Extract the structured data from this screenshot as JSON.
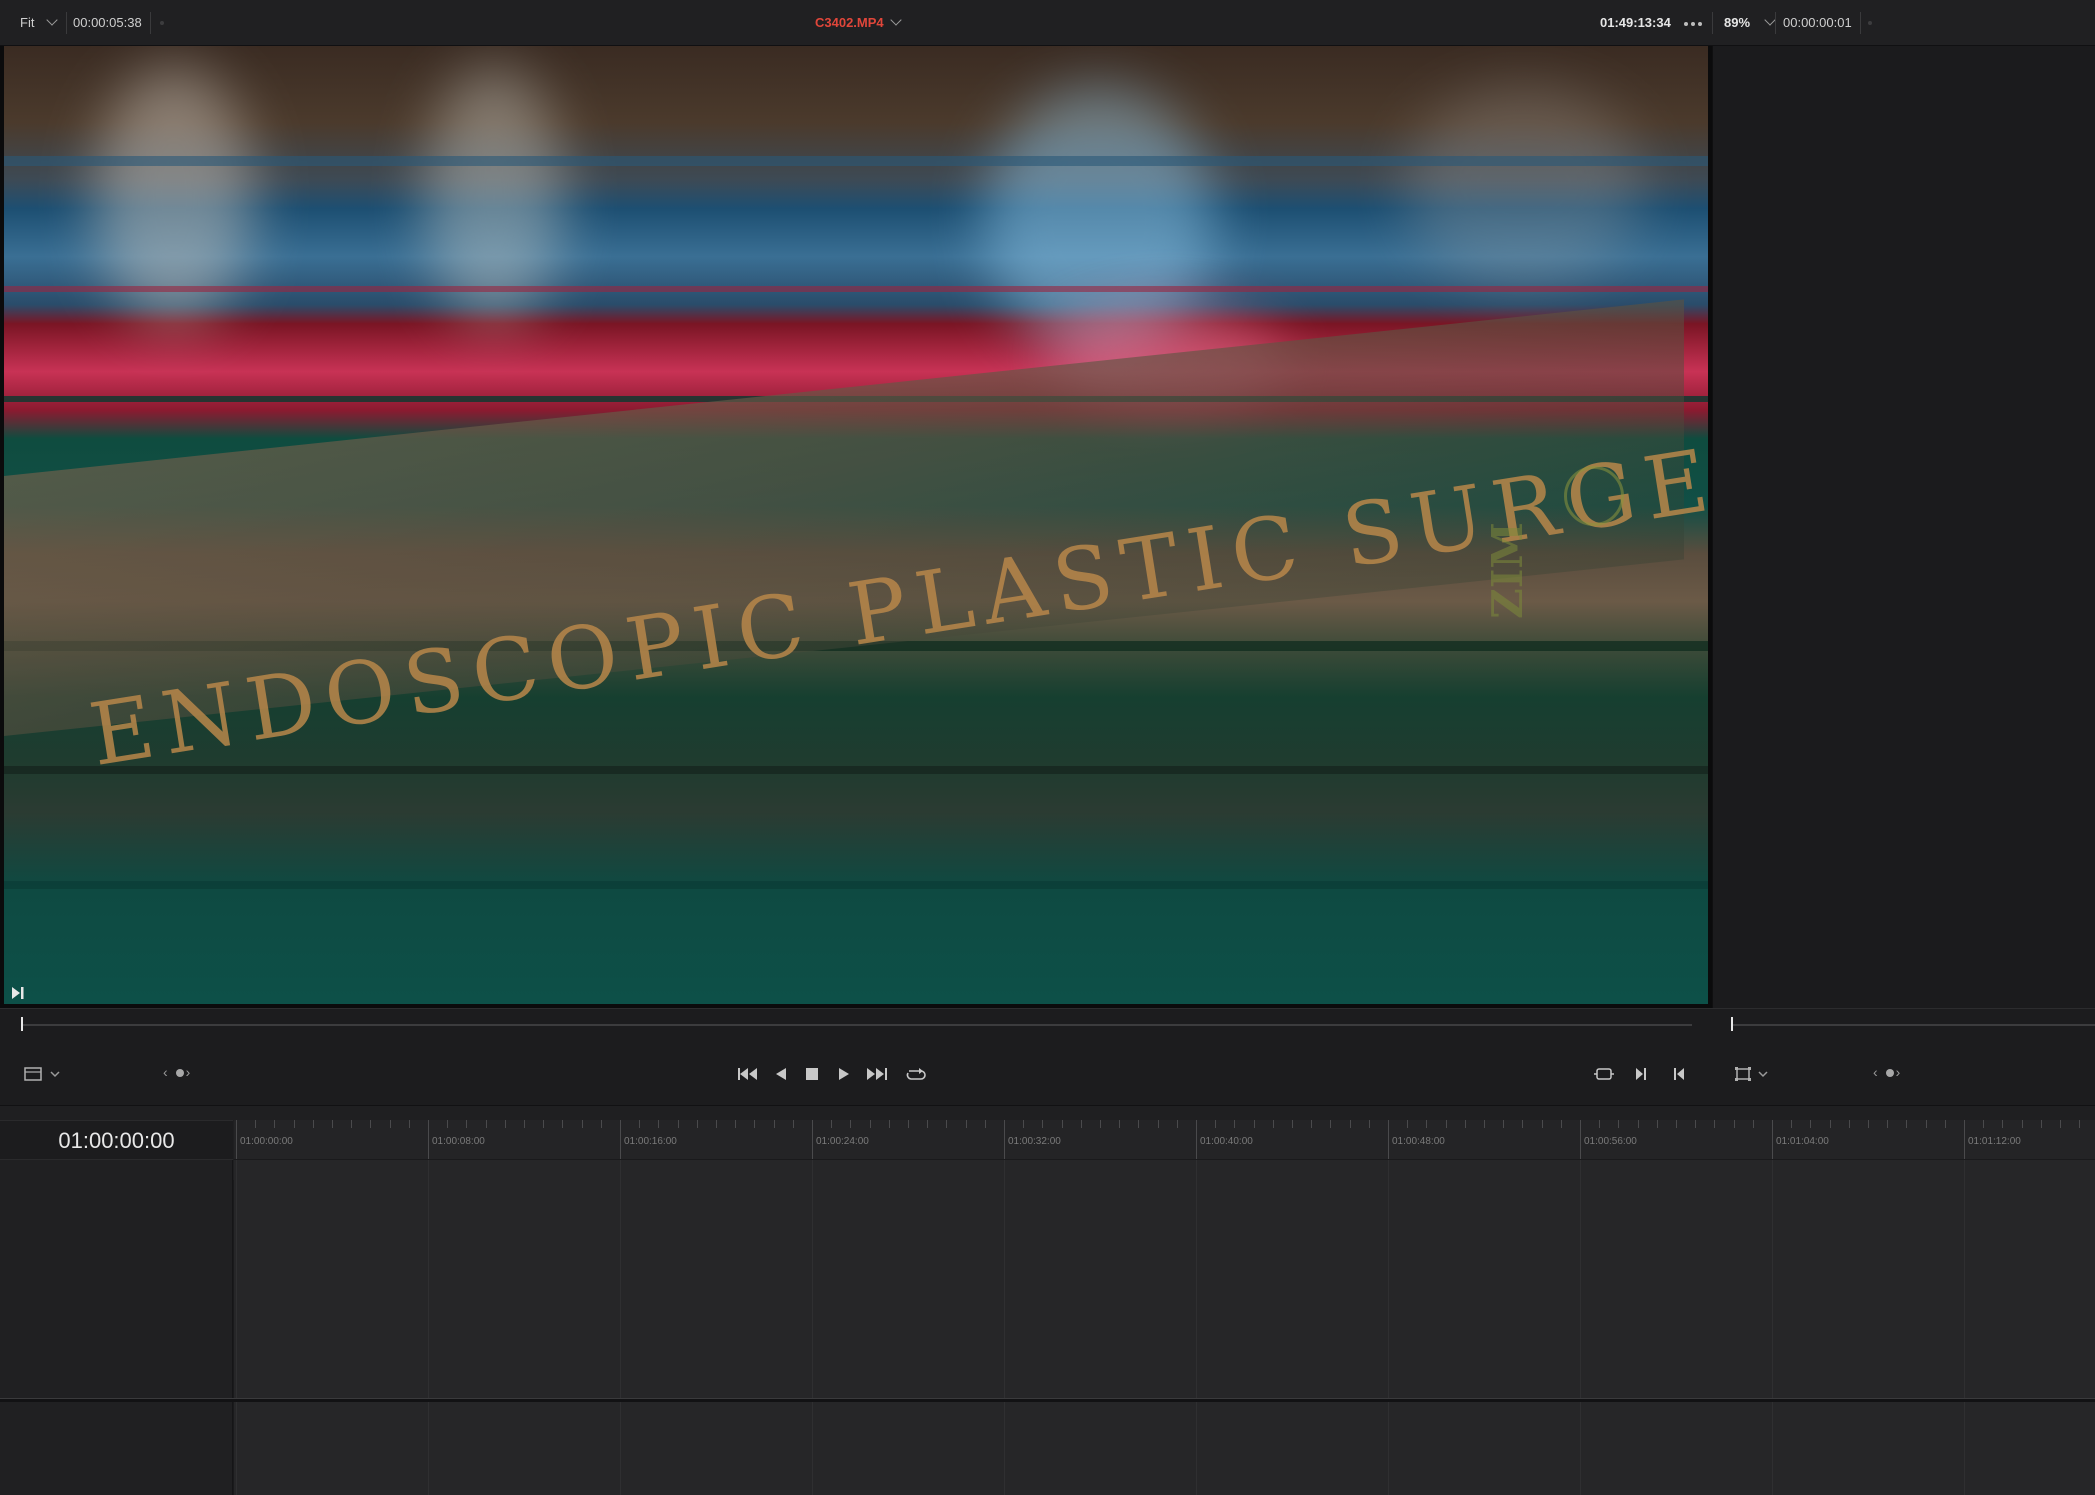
{
  "viewer_header": {
    "zoom_mode": "Fit",
    "source_timecode": "00:00:05:38",
    "clip_name": "C3402.MP4",
    "duration_timecode": "01:49:13:34",
    "zoom_percent": "89%",
    "record_timecode": "00:00:00:01"
  },
  "video_frame": {
    "book_title": "ENDOSCOPIC PLASTIC SURGERY",
    "colors": {
      "blue_band": "#2f6f98",
      "pink_band": "#d23a5c",
      "teal_band": "#0f5046",
      "gold_text": "#b8874a"
    }
  },
  "transport": {
    "icons": [
      "view-mode-icon",
      "jump-to-first-frame-icon",
      "play-reverse-icon",
      "stop-icon",
      "play-icon",
      "jump-to-last-frame-icon",
      "loop-icon",
      "match-frame-icon",
      "mark-out-icon",
      "mark-in-icon",
      "transform-icon"
    ]
  },
  "timeline": {
    "current_timecode": "01:00:00:00",
    "ruler_labels": [
      "01:00:00:00",
      "01:00:08:00",
      "01:00:16:00",
      "01:00:24:00",
      "01:00:32:00",
      "01:00:40:00",
      "01:00:48:00",
      "01:00:56:00",
      "01:01:04:00",
      "01:01:12:00"
    ],
    "toolbar_icons": [
      "timeline-view-options-icon",
      "selection-tool-icon",
      "trim-edit-icon",
      "dynamic-trim-icon",
      "blade-tool-icon",
      "insert-clip-icon",
      "overwrite-clip-icon",
      "replace-clip-icon",
      "snapping-icon",
      "linked-selection-icon",
      "position-lock-icon",
      "flag-icon",
      "marker-icon",
      "zoom-timeline-icon"
    ],
    "accent_color": "#2f7fe0"
  }
}
